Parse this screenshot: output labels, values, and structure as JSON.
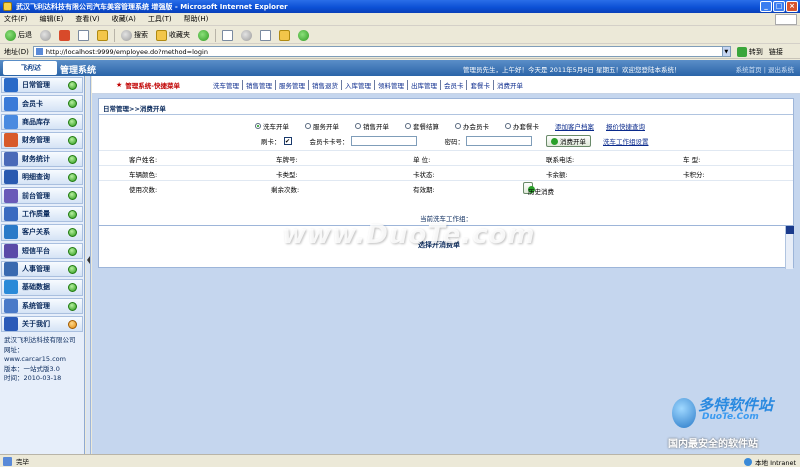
{
  "window": {
    "title": "武汉飞利达科技有限公司汽车美容管理系统 增强版 - Microsoft Internet Explorer",
    "buttons": [
      "_",
      "□",
      "×"
    ]
  },
  "menubar": [
    "文件(F)",
    "编辑(E)",
    "查看(V)",
    "收藏(A)",
    "工具(T)",
    "帮助(H)"
  ],
  "toolbar": {
    "back": "后退",
    "search": "搜索",
    "favorites": "收藏夹"
  },
  "address": {
    "label": "地址(D)",
    "url": "http://localhost:9999/employee.do?method=login",
    "go": "转到",
    "links": "链接"
  },
  "header": {
    "logo": "飞利达",
    "system": "管理系统",
    "message": "管理员先生，上午好！今天是 2011年5月6日 星期五！欢迎您登陆本系统！",
    "links": "系统首页 | 退出系统"
  },
  "sidebar": {
    "items": [
      {
        "label": "日常管理",
        "color": "#2a6ac8",
        "dot": "green"
      },
      {
        "label": "会员卡",
        "color": "#3a7ad8",
        "dot": "green"
      },
      {
        "label": "商品库存",
        "color": "#4a8ae0",
        "dot": "green"
      },
      {
        "label": "财务管理",
        "color": "#d85a2a",
        "dot": "green"
      },
      {
        "label": "财务统计",
        "color": "#4a6ab8",
        "dot": "green"
      },
      {
        "label": "明细查询",
        "color": "#2a5ab0",
        "dot": "green"
      },
      {
        "label": "前台管理",
        "color": "#6a5ab8",
        "dot": "green"
      },
      {
        "label": "工作质量",
        "color": "#3a6ac0",
        "dot": "green"
      },
      {
        "label": "客户关系",
        "color": "#2a7ac8",
        "dot": "green"
      },
      {
        "label": "短信平台",
        "color": "#5a4aa8",
        "dot": "green"
      },
      {
        "label": "人事管理",
        "color": "#3a6ab0",
        "dot": "green"
      },
      {
        "label": "基础数据",
        "color": "#2a8ad8",
        "dot": "green"
      },
      {
        "label": "系统管理",
        "color": "#4a7ac8",
        "dot": "green"
      },
      {
        "label": "关于我们",
        "color": "#2a5ab8",
        "dot": "orange"
      }
    ],
    "info": {
      "company": "武汉飞利达科技有限公司",
      "site_label": "网址：",
      "site": "www.carcar15.com",
      "version": "版本：一站式版3.0",
      "time": "时间：2010-03-18"
    }
  },
  "topnav": {
    "title": "管理系统-快捷菜单",
    "links": [
      "洗车管理",
      "销售管理",
      "服务管理",
      "销售退货",
      "入库管理",
      "领料管理",
      "出库管理",
      "会员卡",
      "套餐卡",
      "消费开单"
    ]
  },
  "content": {
    "breadcrumb": "日常管理>>消费开单",
    "radios": [
      {
        "label": "洗车开单",
        "checked": true
      },
      {
        "label": "服务开单",
        "checked": false
      },
      {
        "label": "销售开单",
        "checked": false
      },
      {
        "label": "套餐结算",
        "checked": false
      },
      {
        "label": "办会员卡",
        "checked": false
      },
      {
        "label": "办套餐卡",
        "checked": false
      }
    ],
    "link_add_customer": "添加客户档案",
    "link_report": "报价快捷查询",
    "card_label": "刷卡：",
    "card_checked": "✔",
    "member_no_label": "会员卡卡号：",
    "password_label": "密码：",
    "consume_button": "消费开单",
    "washer_setting": "洗车工作组设置",
    "rows": [
      [
        "客户姓名:",
        "车牌号:",
        "单 位:",
        "联系电话:",
        "车 型:"
      ],
      [
        "车辆颜色:",
        "卡类型:",
        "卡状态:",
        "卡余额:",
        "卡积分:"
      ],
      [
        "使用次数:",
        "剩余次数:",
        "有效期:"
      ]
    ],
    "history_button": "历史消费",
    "worker_label": "当前洗车工作组：",
    "select_title": "选择开消费单"
  },
  "watermark": "www.DuoTe.com",
  "corner": {
    "big": "多特软件站",
    "small": "DuoTe.Com",
    "tag": "国内最安全的软件站"
  },
  "status": {
    "left": "完毕",
    "zone": "本地 Intranet"
  }
}
